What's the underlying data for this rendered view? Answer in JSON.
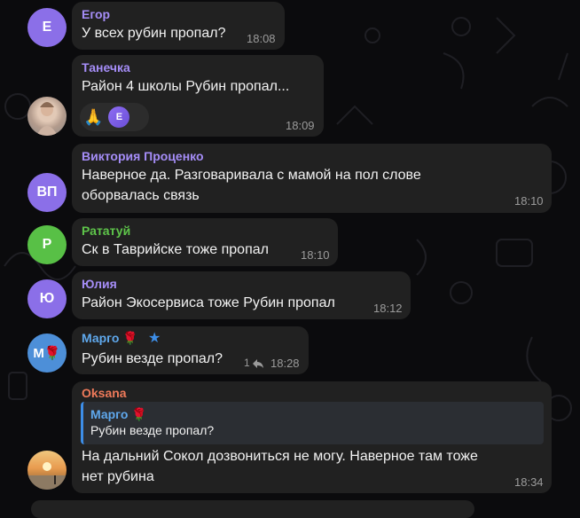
{
  "colors": {
    "background": "#0b0b0d",
    "bubble": "#212121",
    "time": "#9b9b9b",
    "text": "#f2f2f2"
  },
  "messages": [
    {
      "sender": "Егор",
      "sender_color": "#a58df7",
      "avatar_initials": "Е",
      "avatar_bg": "#8b6fe8",
      "text": "У всех рубин пропал?",
      "time": "18:08"
    },
    {
      "sender": "Танечка",
      "sender_color": "#a58df7",
      "avatar_photo": "beach-woman-photo",
      "text": "Район 4 школы Рубин пропал...",
      "reaction_emoji": "🙏",
      "reaction_avatar": "Е",
      "time": "18:09"
    },
    {
      "sender": "Виктория Проценко",
      "sender_color": "#a58df7",
      "avatar_initials": "ВП",
      "avatar_bg": "#8b6fe8",
      "text_line1": "Наверное да. Разговаривала с мамой на пол слове",
      "text_line2": "оборвалась связь",
      "time": "18:10"
    },
    {
      "sender": "Рататуй",
      "sender_color": "#5ec54a",
      "avatar_initials": "Р",
      "avatar_bg": "#58c046",
      "text": "Ск в Таврийске тоже пропал",
      "time": "18:10"
    },
    {
      "sender": "Юлия",
      "sender_color": "#a58df7",
      "avatar_initials": "Ю",
      "avatar_bg": "#8b6fe8",
      "text": "Район Экосервиса тоже Рубин пропал",
      "time": "18:12"
    },
    {
      "sender": "Марго 🌹",
      "sender_color": "#5fa8ec",
      "avatar_initials": "М🌹",
      "avatar_bg": "#4d8fd8",
      "text": "Рубин везде пропал?",
      "reply_count": "1",
      "time": "18:28"
    },
    {
      "sender": "Oksana",
      "sender_color": "#ef7a5a",
      "avatar_photo": "sunset-beach-photo",
      "reply_to_name": "Марго 🌹",
      "reply_to_text": "Рубин везде пропал?",
      "text_line1": "На дальний Сокол дозвониться не могу. Наверное там тоже",
      "text_line2": "нет рубина",
      "time": "18:34"
    }
  ]
}
